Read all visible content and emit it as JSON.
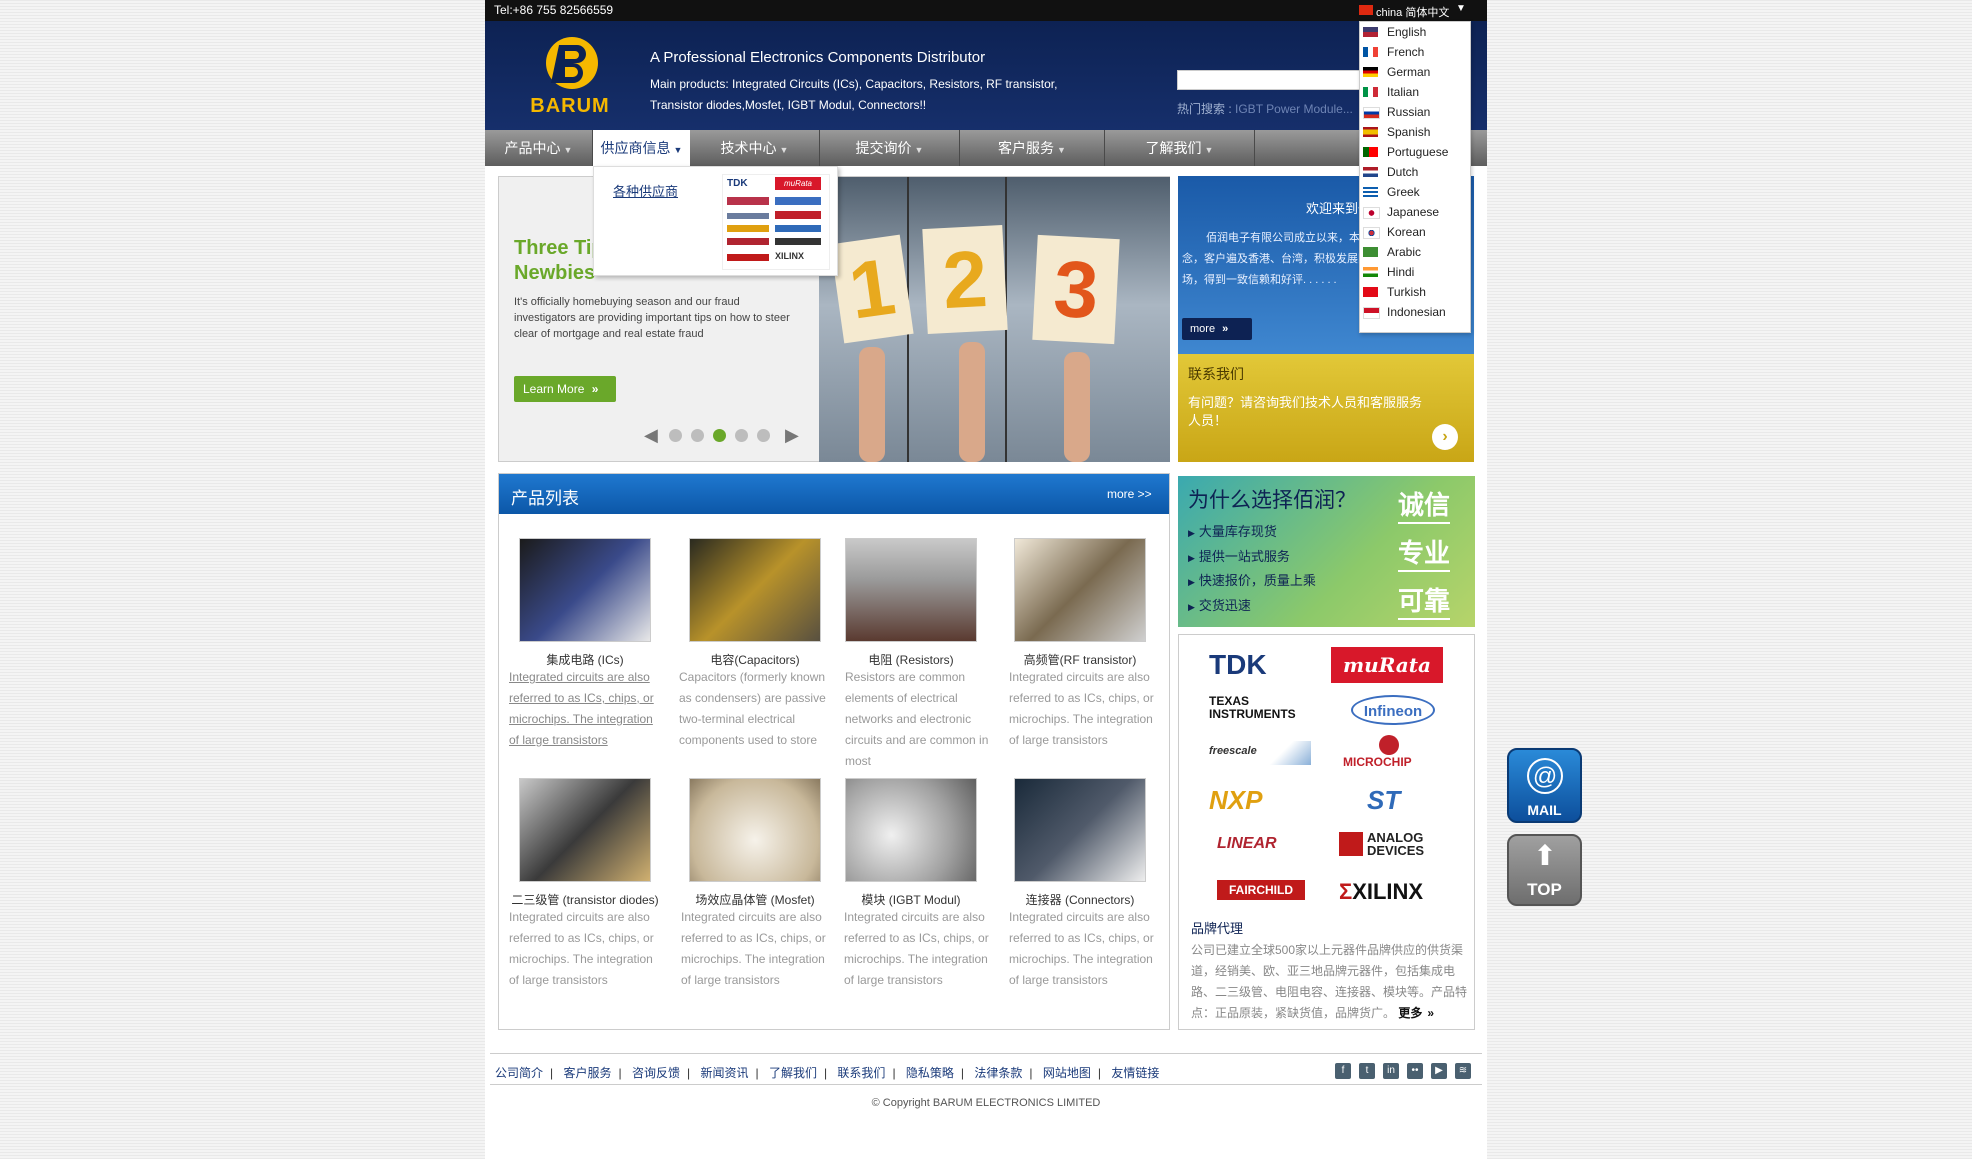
{
  "topbar": {
    "tel": "Tel:+86 755 82566559",
    "lang_current": "china 简体中文"
  },
  "header": {
    "logo_text": "BARUM",
    "tagline": "A Professional Electronics Components Distributor",
    "products_line1": "Main products: Integrated Circuits (ICs), Capacitors, Resistors, RF transistor,",
    "products_line2": "Transistor diodes,Mosfet, IGBT Modul, Connectors!!",
    "search_value": "",
    "hot_search_label": "热门搜索 :",
    "hot_search_terms": "IGBT Power Module..."
  },
  "nav": [
    {
      "label": "产品中心"
    },
    {
      "label": "供应商信息"
    },
    {
      "label": "技术中心"
    },
    {
      "label": "提交询价"
    },
    {
      "label": "客户服务"
    },
    {
      "label": "了解我们"
    }
  ],
  "dropdown": {
    "link": "各种供应商"
  },
  "languages": [
    "English",
    "French",
    "German",
    "Italian",
    "Russian",
    "Spanish",
    "Portuguese",
    "Dutch",
    "Greek",
    "Japanese",
    "Korean",
    "Arabic",
    "Hindi",
    "Turkish",
    "Indonesian"
  ],
  "slider": {
    "title_line1": "Three Tips",
    "title_line2": "Newbies",
    "text": "It's officially homebuying season and our fraud investigators are providing important tips on how to steer clear of mortgage and real estate fraud",
    "button": "Learn More",
    "numbers": [
      "1",
      "2",
      "3"
    ],
    "active_dot": 2
  },
  "welcome": {
    "title": "欢迎来到佰润电子",
    "text": "佰润电子有限公司成立以来，本着互利互惠的经营理念，客户遍及香港、台湾，积极发展国内，外的广阔的市场，得到一致信赖和好评. . . . . .",
    "more": "more"
  },
  "contact": {
    "title": "联系我们",
    "text": "有问题？请咨询我们技术人员和客服服务人员！"
  },
  "products": {
    "title": "产品列表",
    "more": "more >>",
    "items": [
      {
        "name": "集成电路 (ICs)",
        "desc": "Integrated circuits are also referred to as ICs, chips, or microchips. The integration of large transistors"
      },
      {
        "name": "电容(Capacitors)",
        "desc": "Capacitors (formerly known as condensers) are passive two-terminal electrical components used to store"
      },
      {
        "name": "电阻 (Resistors)",
        "desc": "Resistors are common elements of electrical networks and electronic circuits and are common in most"
      },
      {
        "name": "高频管(RF transistor)",
        "desc": "Integrated circuits are also referred to as ICs, chips, or microchips. The integration of large transistors"
      },
      {
        "name": "二三级管 (transistor diodes)",
        "desc": "Integrated circuits are also referred to as ICs, chips, or microchips. The integration of large transistors"
      },
      {
        "name": "场效应晶体管 (Mosfet)",
        "desc": "Integrated circuits are also referred to as ICs, chips, or microchips. The integration of large transistors"
      },
      {
        "name": "模块 (IGBT Modul)",
        "desc": "Integrated circuits are also referred to as ICs, chips, or microchips. The integration of large transistors"
      },
      {
        "name": "连接器 (Connectors)",
        "desc": "Integrated circuits are also referred to as ICs, chips, or microchips. The integration of large transistors"
      }
    ]
  },
  "why": {
    "title": "为什么选择佰润？",
    "points": [
      "大量库存现货",
      "提供一站式服务",
      "快速报价，质量上乘",
      "交货迅速"
    ],
    "words": [
      "诚信",
      "专业",
      "可靠"
    ]
  },
  "brands": {
    "logos": [
      "TDK",
      "muRata",
      "TEXAS INSTRUMENTS",
      "Infineon",
      "freescale",
      "MICROCHIP",
      "NXP",
      "ST",
      "LINEAR",
      "ANALOG DEVICES",
      "FAIRCHILD",
      "XILINX"
    ],
    "title": "品牌代理",
    "text": "公司已建立全球500家以上元器件品牌供应的供货渠道，经销美、欧、亚三地品牌元器件，包括集成电路、二三级管、电阻电容、连接器、模块等。产品特点：正品原装，紧缺货值，品牌货广。",
    "more": "更多"
  },
  "float": {
    "mail": "MAIL",
    "top": "TOP"
  },
  "footer": {
    "links": [
      "公司简介",
      "客户服务",
      "咨询反馈",
      "新闻资讯",
      "了解我们",
      "联系我们",
      "隐私策略",
      "法律条款",
      "网站地图",
      "友情链接"
    ],
    "copyright": "© Copyright BARUM ELECTRONICS LIMITED"
  },
  "colors": {
    "navy": "#0d2253",
    "green": "#6aa82a",
    "blue": "#1565b8",
    "yellow": "#d5b51e"
  }
}
